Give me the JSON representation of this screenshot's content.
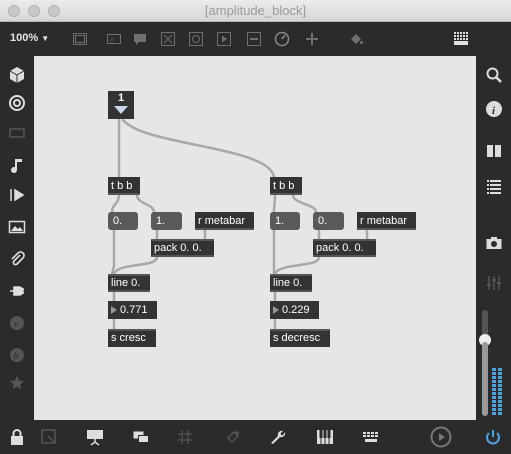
{
  "window": {
    "title": "[amplitude_block]"
  },
  "toolbar": {
    "zoom": "100%"
  },
  "patch": {
    "bang_label": "1",
    "left": {
      "trigger": "t b b",
      "msg0": "0.",
      "msg1": "1.",
      "receive": "r metabar",
      "pack": "pack 0. 0.",
      "line": "line 0.",
      "number": "0.771",
      "send": "s cresc"
    },
    "right": {
      "trigger": "t b b",
      "msg0": "1.",
      "msg1": "0.",
      "receive": "r metabar",
      "pack": "pack 0. 0.",
      "line": "line 0.",
      "number": "0.229",
      "send": "s decresc"
    }
  }
}
